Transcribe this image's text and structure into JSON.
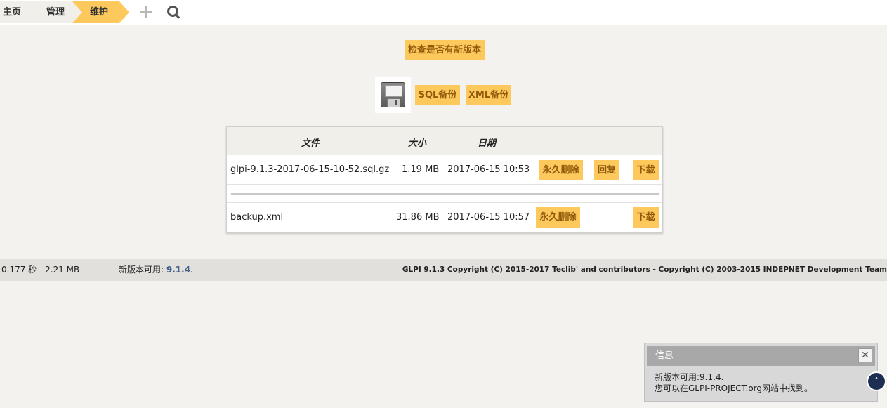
{
  "breadcrumb": {
    "items": [
      {
        "label": "主页"
      },
      {
        "label": "管理"
      },
      {
        "label": "维护"
      }
    ],
    "icons": [
      "plus-icon",
      "search-icon"
    ]
  },
  "actions": {
    "check_version_label": "检查是否有新版本",
    "sql_backup_label": "SQL备份",
    "xml_backup_label": "XML备份",
    "save_icon": "floppy-disk-icon"
  },
  "table": {
    "headers": {
      "file": "文件",
      "size": "大小",
      "date": "日期"
    },
    "rows": [
      {
        "file": "glpi-9.1.3-2017-06-15-10-52.sql.gz",
        "size": "1.19 MB",
        "date": "2017-06-15 10:53",
        "delete": "永久删除",
        "restore": "回复",
        "download": "下载"
      },
      {
        "file": "backup.xml",
        "size": "31.86 MB",
        "date": "2017-06-15 10:57",
        "delete": "永久删除",
        "download": "下载"
      }
    ]
  },
  "footer": {
    "timing": "0.177 秒 - 2.21 MB",
    "new_version_prefix": "新版本可用:",
    "new_version": "9.1.4",
    "new_version_suffix": ".",
    "copyright": "GLPI 9.1.3 Copyright (C) 2015-2017 Teclib' and contributors - Copyright (C) 2003-2015 INDEPNET Development Team"
  },
  "dialog": {
    "title": "信息",
    "line1": "新版本可用:9.1.4.",
    "line2": "您可以在GLPI-PROJECT.org网站中找到。",
    "close_icon": "close-icon"
  },
  "scroll_top": {
    "glyph": "˄"
  },
  "colors": {
    "accent": "#fec95c",
    "button_text": "#8f5a0a",
    "version_link": "#44618c",
    "scroll_button": "#1d2e52"
  }
}
